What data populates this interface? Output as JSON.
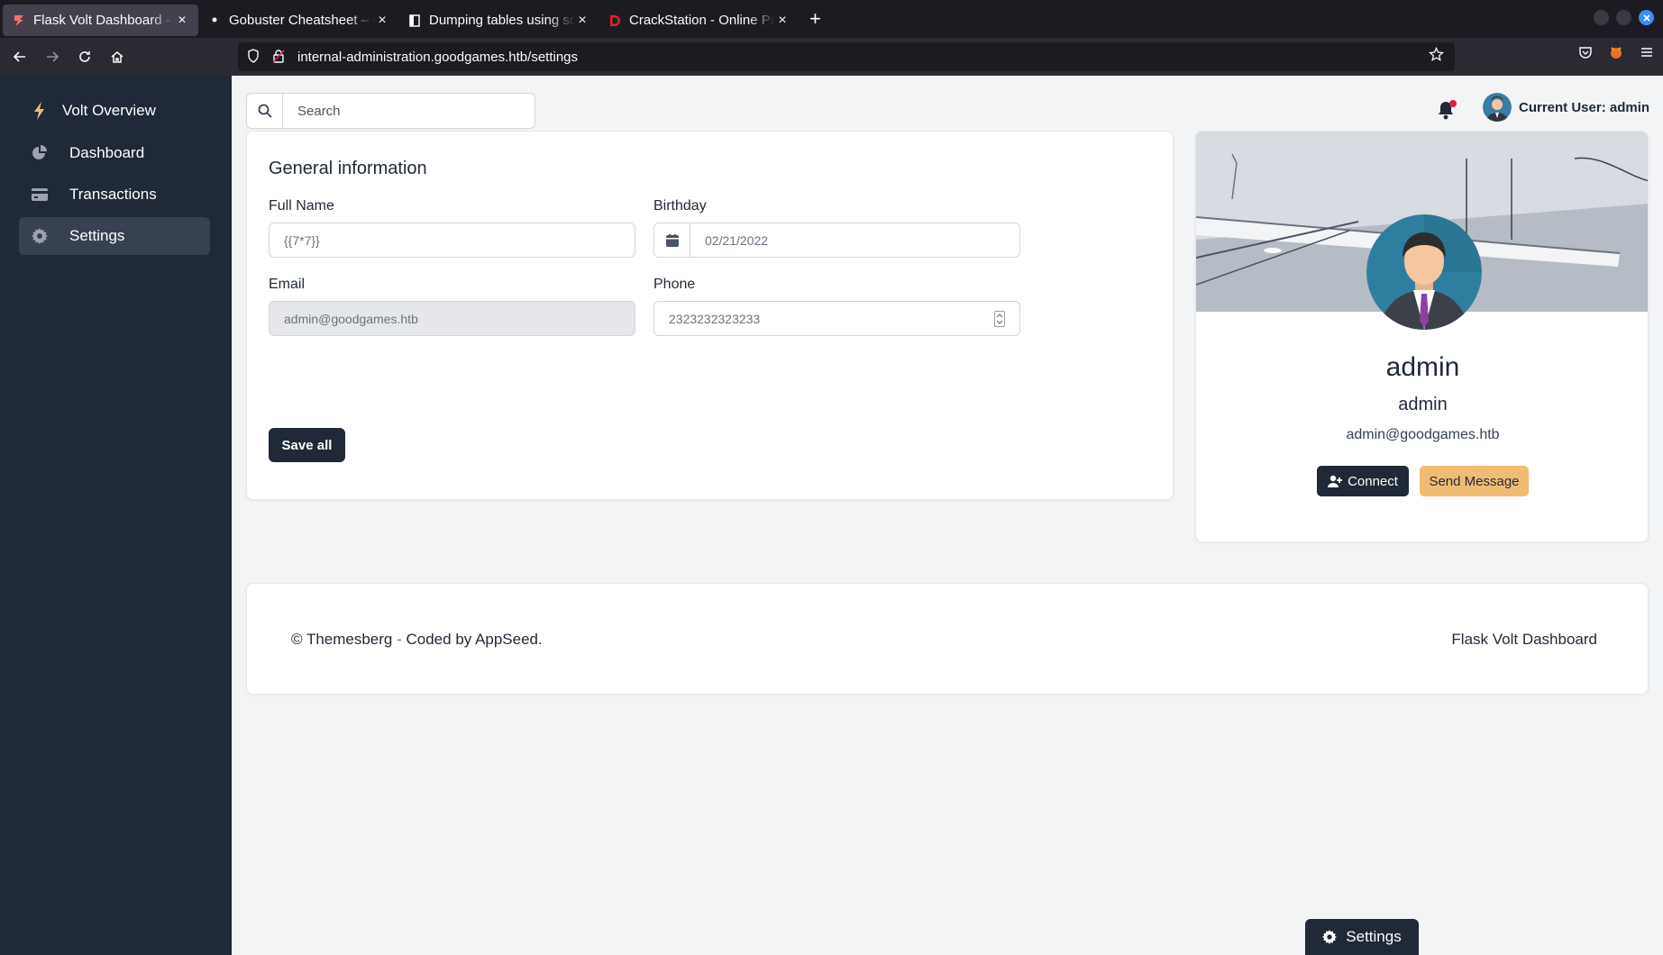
{
  "browser": {
    "tabs": [
      {
        "title": "Flask Volt Dashboard - Upgrade",
        "active": true,
        "favicon": "flask-volt-icon"
      },
      {
        "title": "Gobuster Cheatsheet – GitHub",
        "active": false,
        "favicon": "github-icon"
      },
      {
        "title": "Dumping tables using sqlmap",
        "active": false,
        "favicon": "document-icon"
      },
      {
        "title": "CrackStation - Online Password",
        "active": false,
        "favicon": "crackstation-icon"
      }
    ],
    "close_glyph": "×",
    "new_tab_glyph": "+",
    "url": "internal-administration.goodgames.htb/settings"
  },
  "sidebar": {
    "brand": "Volt Overview",
    "items": [
      {
        "label": "Dashboard",
        "icon": "pie-chart-icon"
      },
      {
        "label": "Transactions",
        "icon": "credit-card-icon"
      },
      {
        "label": "Settings",
        "icon": "gear-icon",
        "active": true
      }
    ]
  },
  "topbar": {
    "search_placeholder": "Search",
    "current_user": "Current User: admin"
  },
  "general": {
    "title": "General information",
    "full_name_label": "Full Name",
    "full_name_value": "{{7*7}}",
    "birthday_label": "Birthday",
    "birthday_value": "02/21/2022",
    "email_label": "Email",
    "email_value": "admin@goodgames.htb",
    "phone_label": "Phone",
    "phone_value": "2323232323233",
    "save_label": "Save all"
  },
  "profile": {
    "name": "admin",
    "username": "admin",
    "email": "admin@goodgames.htb",
    "connect_label": "Connect",
    "message_label": "Send Message"
  },
  "footer": {
    "copyright": "© Themesberg",
    "dash": " - ",
    "coded": "Coded by ",
    "appseed": "AppSeed.",
    "right": "Flask Volt Dashboard"
  },
  "floating": {
    "settings_label": "Settings"
  },
  "colors": {
    "sidebar_bg": "#1f2937",
    "accent_secondary": "#f0bc74",
    "notification_dot": "#e11d48"
  }
}
